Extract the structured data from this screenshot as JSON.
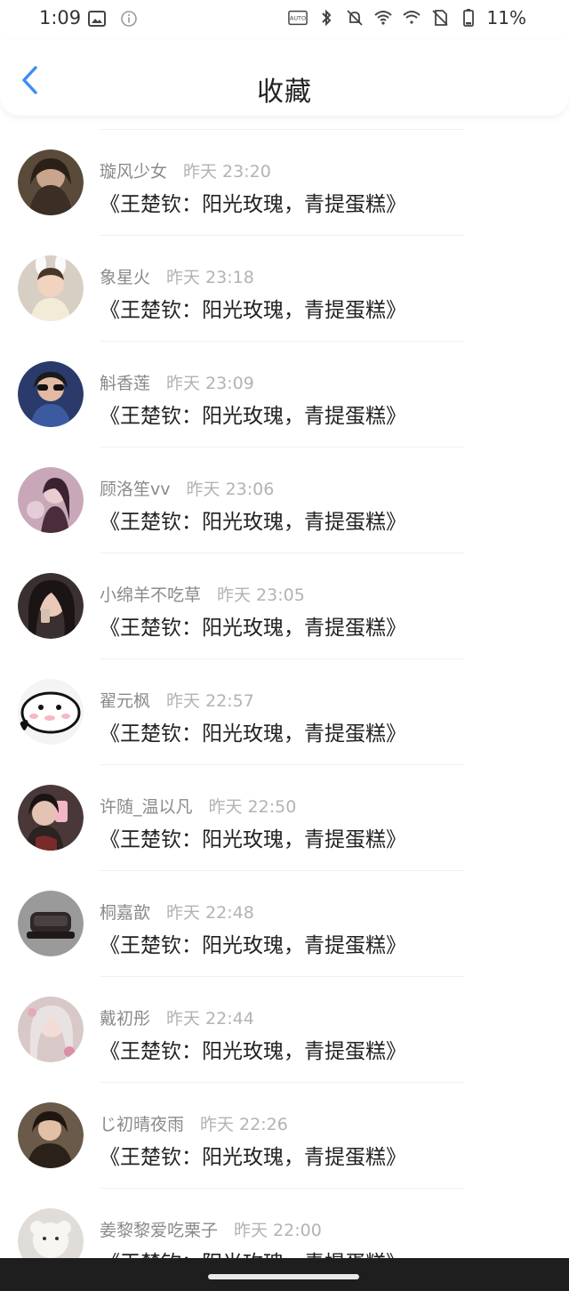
{
  "status_bar": {
    "time": "1:09",
    "battery_text": "11%"
  },
  "header": {
    "title": "收藏",
    "back_icon": "chevron-left-icon",
    "accent_color": "#3a8ef0"
  },
  "favorites": [
    {
      "username": "璇风少女",
      "time": "昨天 23:20",
      "title": "《王楚钦：阳光玫瑰，青提蛋糕》",
      "avatar_color": "#5a4a3a"
    },
    {
      "username": "象星火",
      "time": "昨天 23:18",
      "title": "《王楚钦：阳光玫瑰，青提蛋糕》",
      "avatar_color": "#d8cfc4"
    },
    {
      "username": "斛香莲",
      "time": "昨天 23:09",
      "title": "《王楚钦：阳光玫瑰，青提蛋糕》",
      "avatar_color": "#2a3a6a"
    },
    {
      "username": "顾洛笙vv",
      "time": "昨天 23:06",
      "title": "《王楚钦：阳光玫瑰，青提蛋糕》",
      "avatar_color": "#c8a8b8"
    },
    {
      "username": "小绵羊不吃草",
      "time": "昨天 23:05",
      "title": "《王楚钦：阳光玫瑰，青提蛋糕》",
      "avatar_color": "#3a3030"
    },
    {
      "username": "翟元枫",
      "time": "昨天 22:57",
      "title": "《王楚钦：阳光玫瑰，青提蛋糕》",
      "avatar_color": "#f4f4f4"
    },
    {
      "username": "许随_温以凡",
      "time": "昨天 22:50",
      "title": "《王楚钦：阳光玫瑰，青提蛋糕》",
      "avatar_color": "#4a3838"
    },
    {
      "username": "桐嘉歆",
      "time": "昨天 22:48",
      "title": "《王楚钦：阳光玫瑰，青提蛋糕》",
      "avatar_color": "#9a9a9a"
    },
    {
      "username": "戴初彤",
      "time": "昨天 22:44",
      "title": "《王楚钦：阳光玫瑰，青提蛋糕》",
      "avatar_color": "#d8c8c8"
    },
    {
      "username": "じ初晴夜雨",
      "time": "昨天 22:26",
      "title": "《王楚钦：阳光玫瑰，青提蛋糕》",
      "avatar_color": "#6a5a4a"
    },
    {
      "username": "姜黎黎爱吃栗子",
      "time": "昨天 22:00",
      "title": "《王楚钦：阳光玫瑰，青提蛋糕》",
      "avatar_color": "#e0dcd8"
    }
  ]
}
